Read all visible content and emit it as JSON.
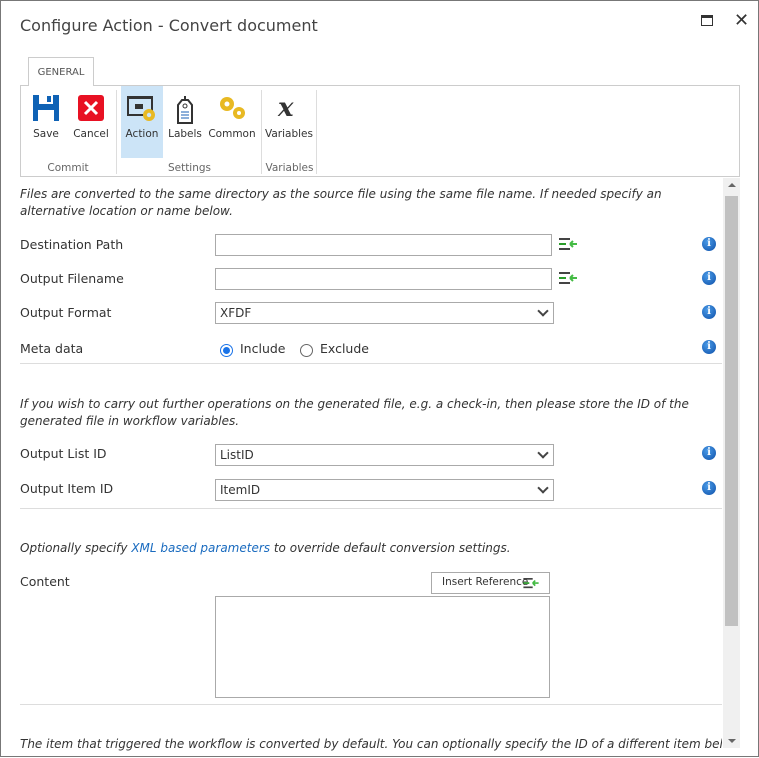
{
  "window": {
    "title": "Configure Action - Convert document"
  },
  "ribbon": {
    "tab": "GENERAL",
    "buttons": {
      "save": "Save",
      "cancel": "Cancel",
      "action": "Action",
      "labels": "Labels",
      "common": "Common",
      "variables": "Variables"
    },
    "groups": {
      "commit": "Commit",
      "settings": "Settings",
      "variables": "Variables"
    }
  },
  "form": {
    "note1": "Files are converted to the same directory as the source file using the same file name. If needed specify an alternative location or name below.",
    "destination_path": {
      "label": "Destination Path",
      "value": ""
    },
    "output_filename": {
      "label": "Output Filename",
      "value": ""
    },
    "output_format": {
      "label": "Output Format",
      "value": "XFDF"
    },
    "meta_data": {
      "label": "Meta data",
      "include": "Include",
      "exclude": "Exclude",
      "selected": "Include"
    },
    "note2": "If you wish to carry out further operations on the generated file, e.g. a check-in, then please store the ID of the generated file in workflow variables.",
    "output_list_id": {
      "label": "Output List ID",
      "value": "ListID"
    },
    "output_item_id": {
      "label": "Output Item ID",
      "value": "ItemID"
    },
    "note3_pre": "Optionally specify ",
    "note3_link": "XML based parameters",
    "note3_post": " to override default conversion settings.",
    "content": {
      "label": "Content",
      "insert_reference": "Insert Reference",
      "value": ""
    },
    "note4": "The item that triggered the workflow is converted by default. You can optionally specify the ID of a different item below using"
  }
}
